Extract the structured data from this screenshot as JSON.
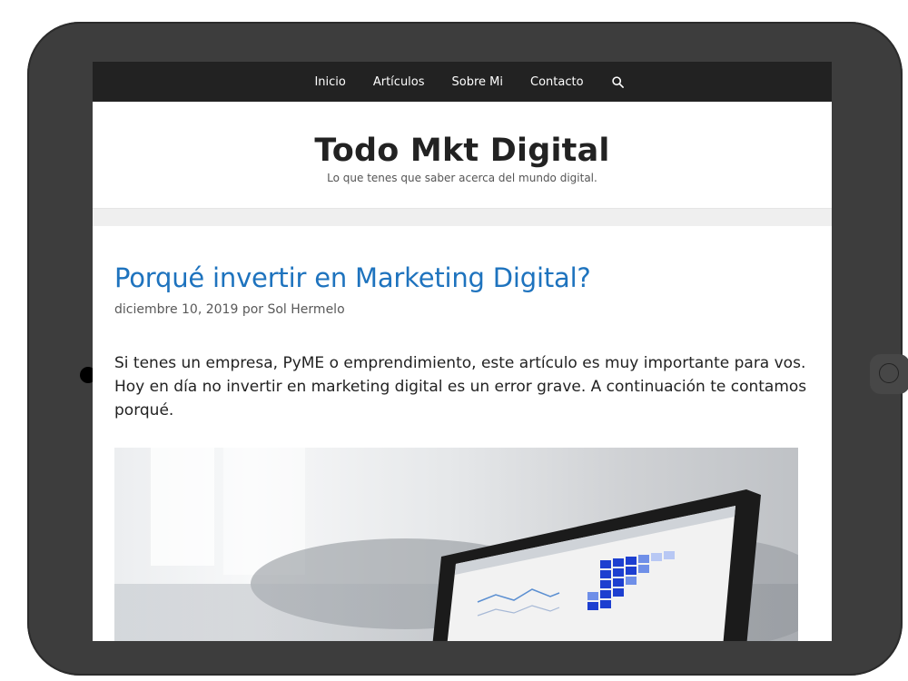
{
  "nav": {
    "items": [
      "Inicio",
      "Artículos",
      "Sobre Mi",
      "Contacto"
    ]
  },
  "site": {
    "title": "Todo Mkt Digital",
    "description": "Lo que tenes que saber acerca del mundo digital."
  },
  "post": {
    "title": "Porqué invertir en Marketing Digital?",
    "date": "diciembre 10, 2019",
    "by": "por",
    "author": "Sol Hermelo",
    "excerpt": "Si tenes un empresa, PyME o emprendimiento, este artículo es muy importante para vos. Hoy en día no invertir en marketing digital es un error grave. A continuación te contamos porqué."
  },
  "colors": {
    "nav_bg": "#222222",
    "link": "#1e73be",
    "tablet_frame": "#3d3d3d"
  },
  "icons": {
    "search": "search-icon"
  }
}
